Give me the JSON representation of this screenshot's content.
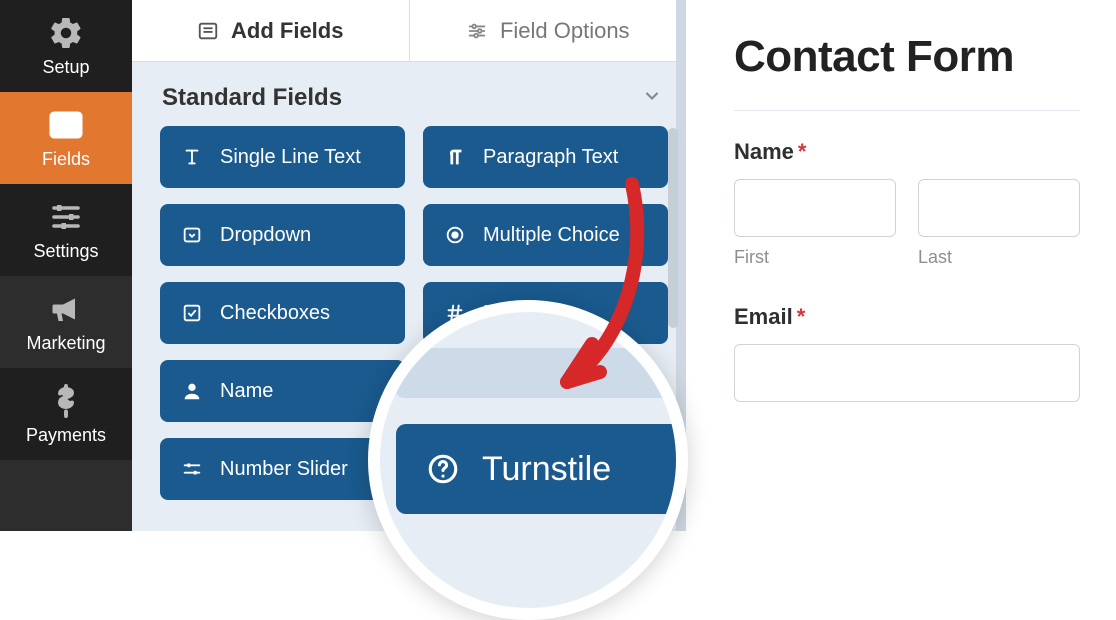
{
  "nav": {
    "items": [
      {
        "key": "setup",
        "label": "Setup"
      },
      {
        "key": "fields",
        "label": "Fields"
      },
      {
        "key": "settings",
        "label": "Settings"
      },
      {
        "key": "marketing",
        "label": "Marketing"
      },
      {
        "key": "payments",
        "label": "Payments"
      }
    ],
    "active": "fields"
  },
  "tabs": {
    "add_fields": "Add Fields",
    "field_options": "Field Options",
    "active": "add_fields"
  },
  "section": {
    "title": "Standard Fields"
  },
  "fields": {
    "single_line_text": "Single Line Text",
    "paragraph_text": "Paragraph Text",
    "dropdown": "Dropdown",
    "multiple_choice": "Multiple Choice",
    "checkboxes": "Checkboxes",
    "numbers": "Numbers",
    "name": "Name",
    "number_slider": "Number Slider"
  },
  "highlight": {
    "field_label": "Turnstile"
  },
  "preview": {
    "form_title": "Contact Form",
    "name_label": "Name",
    "first_sub": "First",
    "last_sub": "Last",
    "email_label": "Email",
    "required_marker": "*"
  },
  "colors": {
    "nav_bg": "#2d2d2d",
    "nav_active": "#e27730",
    "panel_bg": "#e6edf4",
    "field_btn": "#1a5a8e",
    "arrow": "#d62828"
  }
}
